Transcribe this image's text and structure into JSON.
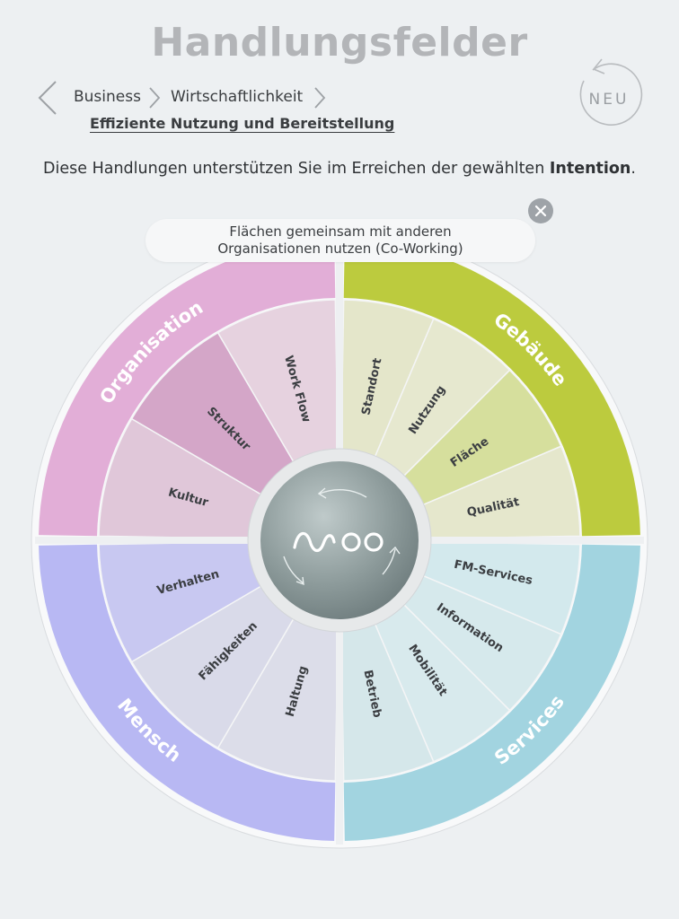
{
  "header": {
    "title": "Handlungsfelder",
    "breadcrumbs": [
      "Business",
      "Wirtschaftlichkeit"
    ],
    "active": "Effiziente Nutzung und Bereitstellung",
    "badge": "NEU"
  },
  "intro": {
    "text": "Diese Handlungen unterstützen Sie im Erreichen der gewählten ",
    "emphasis": "Intention",
    "end": "."
  },
  "tooltip": {
    "line1": "Flächen gemeinsam mit anderen",
    "line2": "Organisationen nutzen (Co-Working)"
  },
  "wheel": {
    "quadrants": [
      {
        "name": "Organisation",
        "ring_color": "#e2aed7",
        "inner_color": "#d5a3c9",
        "items": [
          {
            "label": "Kultur",
            "color": "#e0c7d9"
          },
          {
            "label": "Struktur",
            "color": "#d4a6c8"
          },
          {
            "label": "Work Flow",
            "color": "#e6d2df"
          }
        ]
      },
      {
        "name": "Gebäude",
        "ring_color": "#bccb3e",
        "inner_color": "#dfe2bf",
        "items": [
          {
            "label": "Standort",
            "color": "#e4e6ca"
          },
          {
            "label": "Nutzung",
            "color": "#e6e8cf"
          },
          {
            "label": "Fläche",
            "color": "#d6df9d"
          },
          {
            "label": "Qualität",
            "color": "#e5e7cc"
          }
        ]
      },
      {
        "name": "Services",
        "ring_color": "#a2d4e0",
        "inner_color": "#d3e6ea",
        "items": [
          {
            "label": "FM-Services",
            "color": "#d3e9ed"
          },
          {
            "label": "Information",
            "color": "#d6e9ec"
          },
          {
            "label": "Mobilität",
            "color": "#d8eaed"
          },
          {
            "label": "Betrieb",
            "color": "#d5e7ea"
          }
        ]
      },
      {
        "name": "Mensch",
        "ring_color": "#b8b8f3",
        "inner_color": "#d7d7ee",
        "items": [
          {
            "label": "Haltung",
            "color": "#dcdde9"
          },
          {
            "label": "Fähigkeiten",
            "color": "#d9dae9"
          },
          {
            "label": "Verhalten",
            "color": "#c8c8f1"
          }
        ]
      }
    ],
    "center_logo": "nuoo-logo"
  }
}
